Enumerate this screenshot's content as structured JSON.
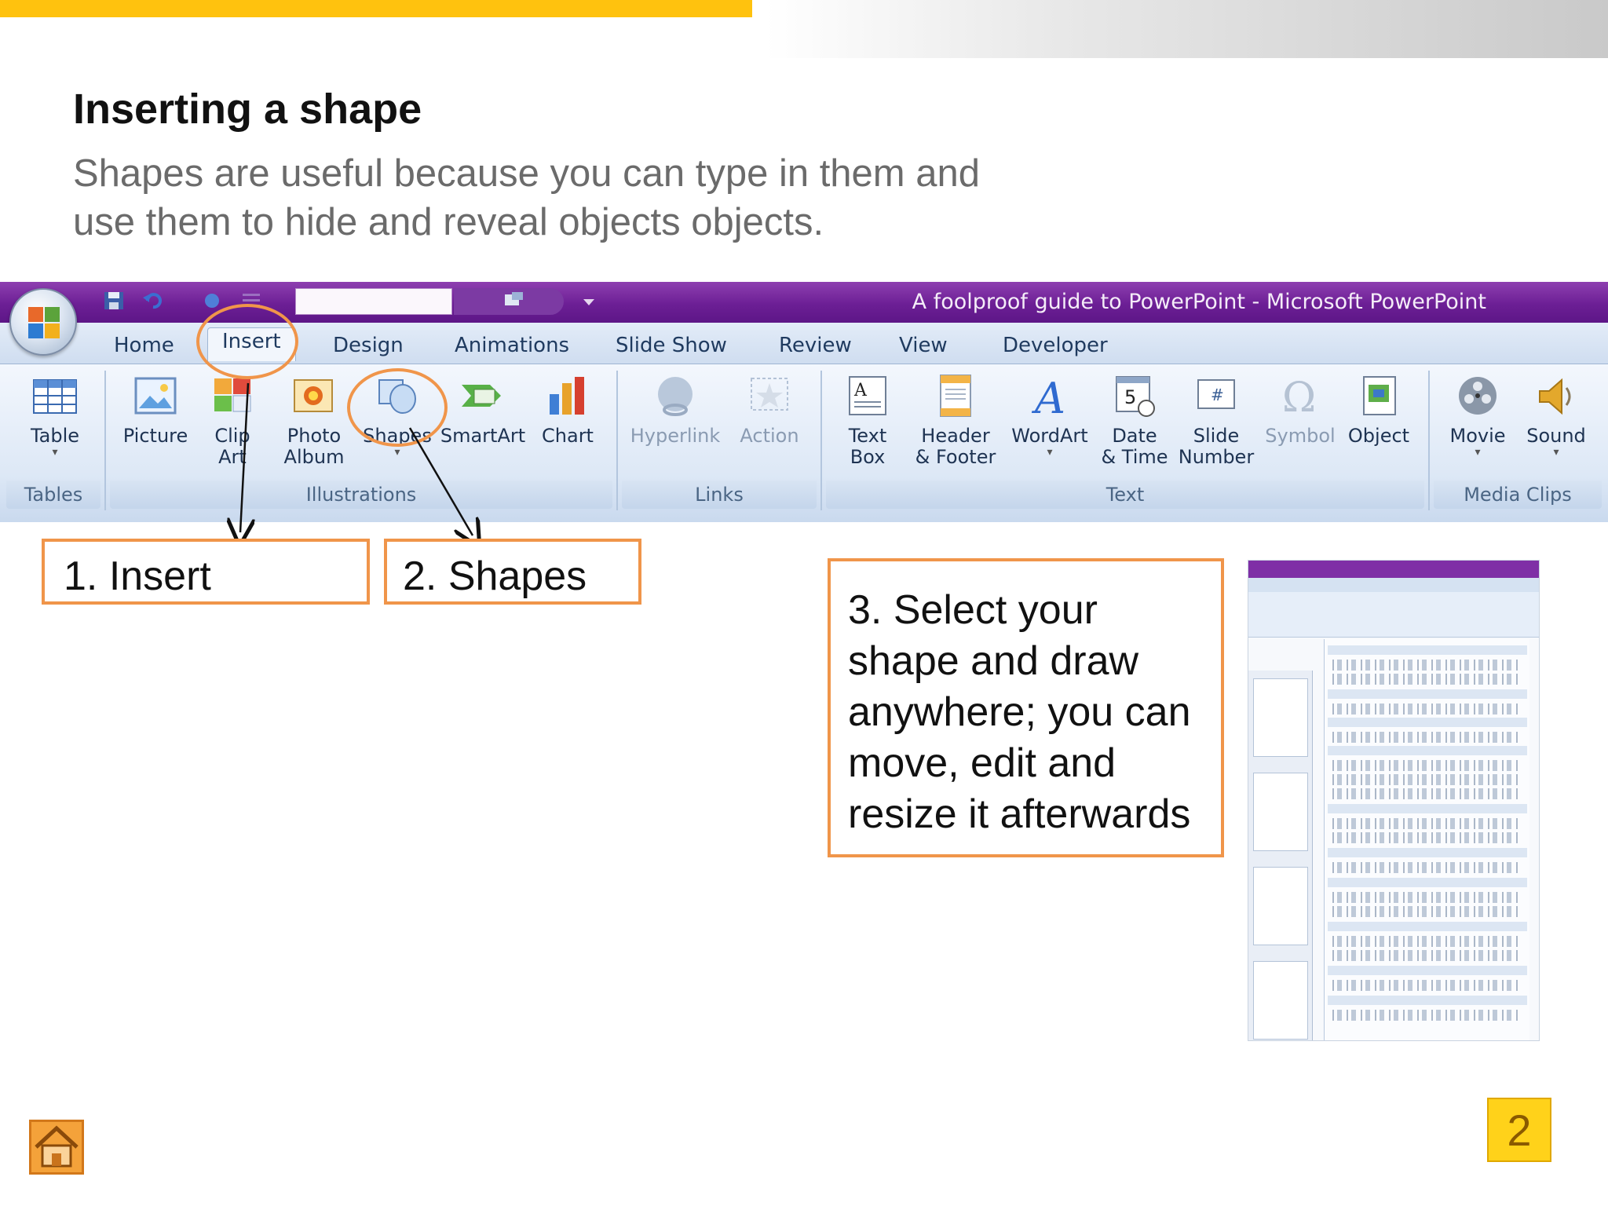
{
  "slide": {
    "title": "Inserting a shape",
    "subtitle_line1": "Shapes are useful because you can type in them and",
    "subtitle_line2": "use them to hide and reveal objects objects.",
    "page_number": "2"
  },
  "window": {
    "title": "A foolproof guide to PowerPoint - Microsoft PowerPoint"
  },
  "tabs": [
    "Home",
    "Insert",
    "Design",
    "Animations",
    "Slide Show",
    "Review",
    "View",
    "Developer"
  ],
  "groups": {
    "tables": {
      "label": "Tables",
      "buttons": [
        {
          "line1": "Table",
          "line2": ""
        }
      ]
    },
    "illustrations": {
      "label": "Illustrations",
      "buttons": [
        {
          "line1": "Picture",
          "line2": ""
        },
        {
          "line1": "Clip",
          "line2": "Art"
        },
        {
          "line1": "Photo",
          "line2": "Album"
        },
        {
          "line1": "Shapes",
          "line2": ""
        },
        {
          "line1": "SmartArt",
          "line2": ""
        },
        {
          "line1": "Chart",
          "line2": ""
        }
      ]
    },
    "links": {
      "label": "Links",
      "buttons": [
        {
          "line1": "Hyperlink",
          "line2": ""
        },
        {
          "line1": "Action",
          "line2": ""
        }
      ]
    },
    "text": {
      "label": "Text",
      "buttons": [
        {
          "line1": "Text",
          "line2": "Box"
        },
        {
          "line1": "Header",
          "line2": "& Footer"
        },
        {
          "line1": "WordArt",
          "line2": ""
        },
        {
          "line1": "Date",
          "line2": "& Time"
        },
        {
          "line1": "Slide",
          "line2": "Number"
        },
        {
          "line1": "Symbol",
          "line2": ""
        },
        {
          "line1": "Object",
          "line2": ""
        }
      ]
    },
    "media": {
      "label": "Media Clips",
      "buttons": [
        {
          "line1": "Movie",
          "line2": ""
        },
        {
          "line1": "Sound",
          "line2": ""
        }
      ]
    }
  },
  "callouts": {
    "step1": "1. Insert",
    "step2": "2. Shapes",
    "step3_lines": [
      "3. Select your",
      "shape and draw",
      "anywhere; you can",
      "move, edit and",
      "resize it afterwards"
    ]
  },
  "colors": {
    "accent_gold": "#ffc20e",
    "callout_orange": "#f0954a",
    "titlebar_purple": "#6c1f95",
    "ribbon_blue": "#dde8f6"
  },
  "icons": {
    "home": "home-icon"
  }
}
